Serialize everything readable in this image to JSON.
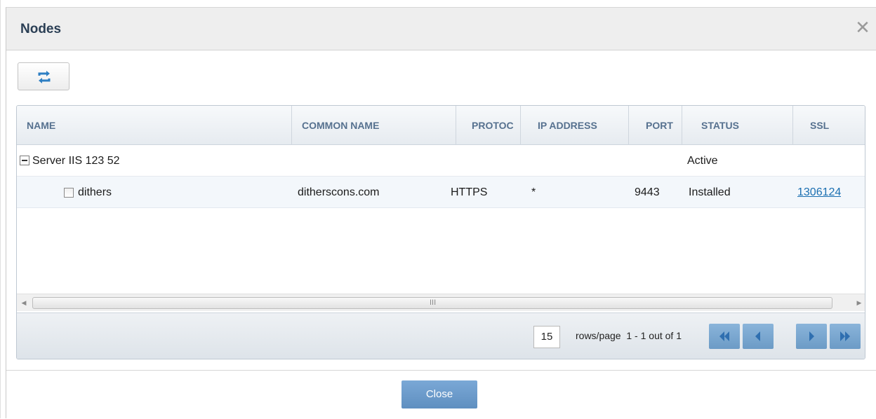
{
  "dialog": {
    "title": "Nodes",
    "close_icon": "close-icon"
  },
  "toolbar": {
    "refresh_icon": "refresh-icon"
  },
  "grid": {
    "columns": [
      "NAME",
      "COMMON NAME",
      "PROTOC",
      "IP ADDRESS",
      "PORT",
      "STATUS",
      "SSL"
    ],
    "group": {
      "name": "Server IIS 123 52",
      "status": "Active"
    },
    "rows": [
      {
        "name": "dithers",
        "common_name": "ditherscons.com",
        "protocol": "HTTPS",
        "ip_address": "*",
        "port": "9443",
        "status": "Installed",
        "ssl": "1306124"
      }
    ],
    "scroll_grip": "III"
  },
  "pager": {
    "rows_per_page": "15",
    "rows_label": "rows/page",
    "range": "1 - 1 out of 1"
  },
  "footer": {
    "close_label": "Close"
  },
  "colors": {
    "accent": "#6c9bc6",
    "header_text": "#56718f",
    "link": "#1a6fb1"
  }
}
